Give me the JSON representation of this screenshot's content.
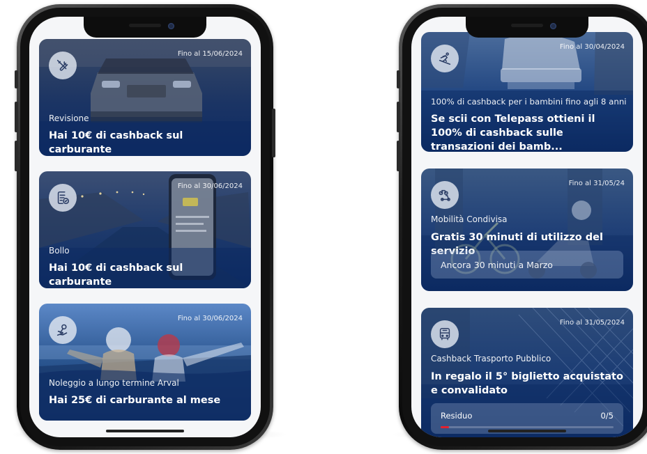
{
  "left_phone": {
    "cards": [
      {
        "icon": "tools-icon",
        "date": "Fino al 15/06/2024",
        "category": "Revisione",
        "headline": "Hai 10€ di cashback sul carburante"
      },
      {
        "icon": "document-check-icon",
        "date": "Fino al 30/06/2024",
        "category": "Bollo",
        "headline": "Hai 10€ di cashback sul carburante"
      },
      {
        "icon": "hand-key-icon",
        "date": "Fino al 30/06/2024",
        "category": "Noleggio a lungo termine Arval",
        "headline": "Hai 25€ di carburante al mese"
      }
    ]
  },
  "right_phone": {
    "cards": [
      {
        "icon": "skier-icon",
        "date": "Fino al 30/04/2024",
        "category": "100% di cashback per i bambini fino agli 8 anni",
        "headline": "Se scii con Telepass ottieni il 100% di cashback sulle transazioni  dei bamb..."
      },
      {
        "icon": "bike-scooter-icon",
        "date": "Fino al 31/05/24",
        "category": "Mobilità Condivisa",
        "headline": "Gratis 30 minuti di utilizzo del servizio",
        "info": "Ancora 30 minuti a Marzo"
      },
      {
        "icon": "bus-icon",
        "date": "Fino al 31/05/2024",
        "category": "Cashback Trasporto Pubblico",
        "headline": "In regalo il 5° biglietto acquistato e convalidato",
        "progress_label": "Residuo",
        "progress_value": "0/5",
        "progress_fraction": 0.05
      }
    ]
  },
  "colors": {
    "card_navy": "#0d2f6b",
    "accent_red": "#e4212f"
  }
}
